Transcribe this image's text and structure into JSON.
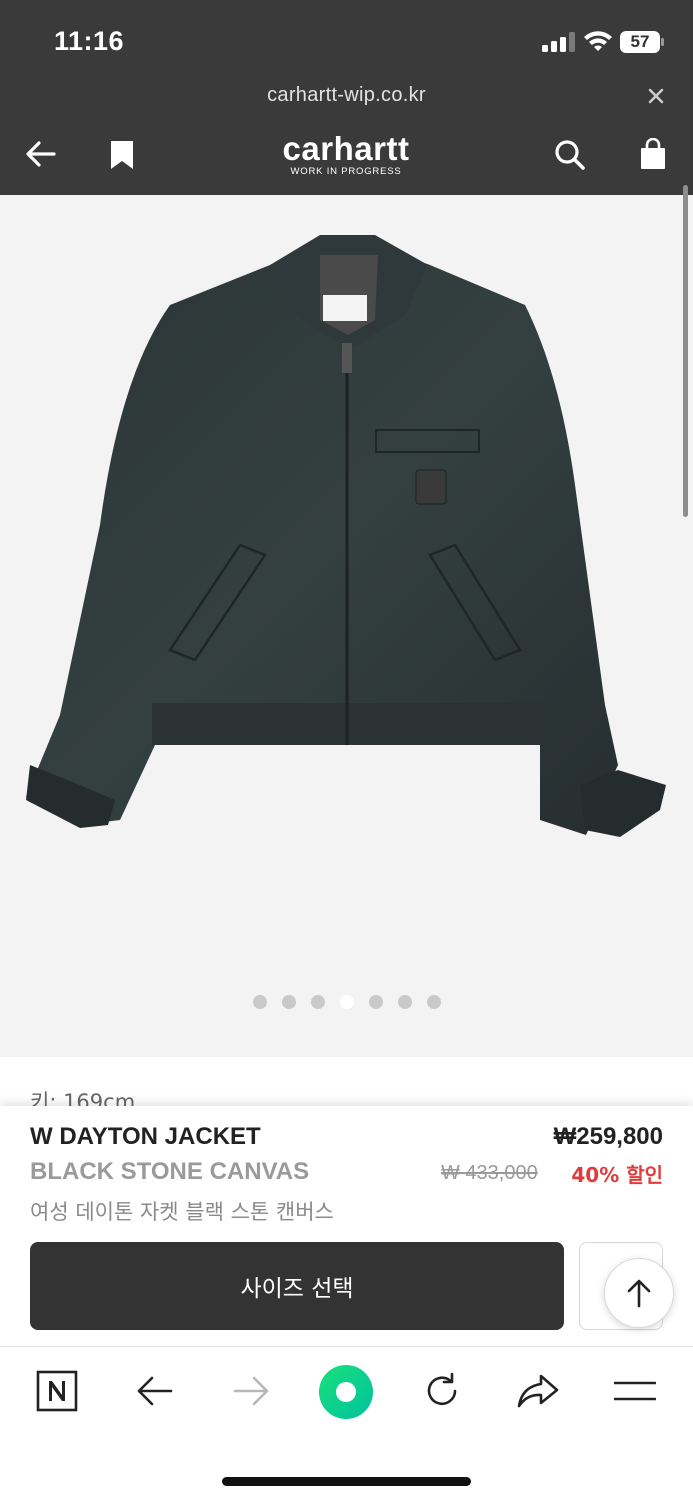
{
  "status_bar": {
    "time": "11:16",
    "battery": "57"
  },
  "browser": {
    "url": "carhartt-wip.co.kr"
  },
  "header": {
    "logo": "carhartt",
    "logo_sub": "WORK IN PROGRESS"
  },
  "gallery": {
    "slide_count": 7,
    "active_index": 3
  },
  "peek_text": "키: 169cm",
  "product": {
    "name": "W DAYTON JACKET",
    "color": "BLACK STONE CANVAS",
    "name_kr": "여성 데이톤 자켓 블랙 스톤 캔버스",
    "price": "₩259,800",
    "original_price": "₩ 433,000",
    "discount": "40% 할인"
  },
  "actions": {
    "size_select": "사이즈 선택"
  },
  "icons": {
    "header": [
      "back-arrow-icon",
      "bookmark-icon",
      "search-icon",
      "shopping-bag-icon"
    ],
    "toolbar": [
      "naver-n-icon",
      "back-arrow-icon",
      "forward-arrow-icon",
      "green-dot-icon",
      "refresh-icon",
      "share-icon",
      "menu-icon"
    ]
  },
  "colors": {
    "header_bg": "#3a3a3a",
    "discount": "#e03c3c",
    "button_dark": "#333333",
    "naver_green": "#03c75a"
  }
}
